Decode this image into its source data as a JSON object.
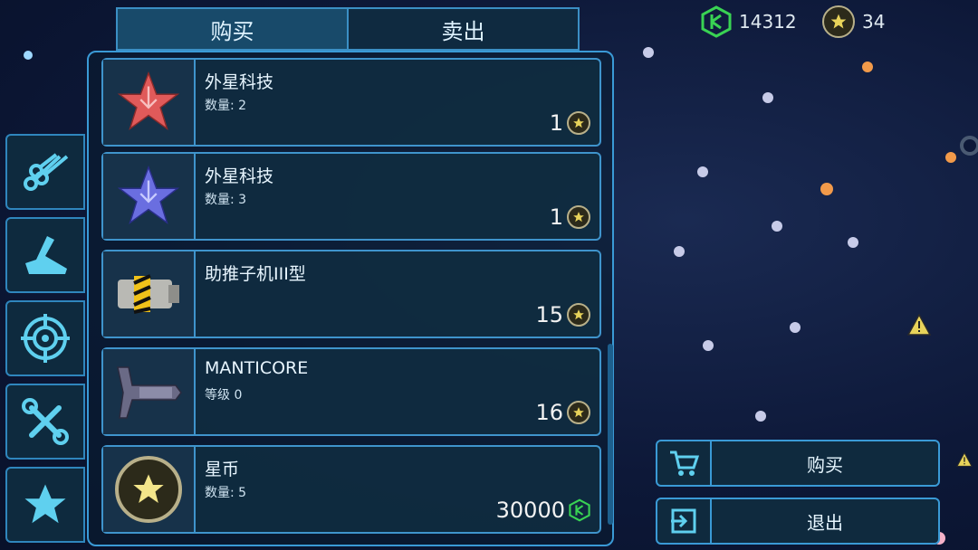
{
  "tabs": {
    "buy": "购买",
    "sell": "卖出"
  },
  "currency": {
    "green_amount": "14312",
    "stars_amount": "34"
  },
  "items": [
    {
      "name": "外星科技",
      "detail": "数量: 2",
      "price": "1",
      "price_icon": "star-coin-icon",
      "icon": "red-circuit-star-icon"
    },
    {
      "name": "外星科技",
      "detail": "数量: 3",
      "price": "1",
      "price_icon": "star-coin-icon",
      "icon": "blue-circuit-star-icon"
    },
    {
      "name": "助推子机III型",
      "detail": "",
      "price": "15",
      "price_icon": "star-coin-icon",
      "icon": "booster-module-icon"
    },
    {
      "name": "MANTICORE",
      "detail": "等级 0",
      "price": "16",
      "price_icon": "star-coin-icon",
      "icon": "manticore-ship-icon"
    },
    {
      "name": "星币",
      "detail": "数量: 5",
      "price": "30000",
      "price_icon": "green-cube-currency-icon",
      "icon": "star-coin-large-icon"
    }
  ],
  "actions": {
    "buy": "购买",
    "exit": "退出"
  },
  "colors": {
    "accent": "#3a9ad6",
    "green_currency": "#39d353",
    "gold": "#e8d35a",
    "red_star": "#e05a5a",
    "blue_star": "#6a6ee0"
  }
}
